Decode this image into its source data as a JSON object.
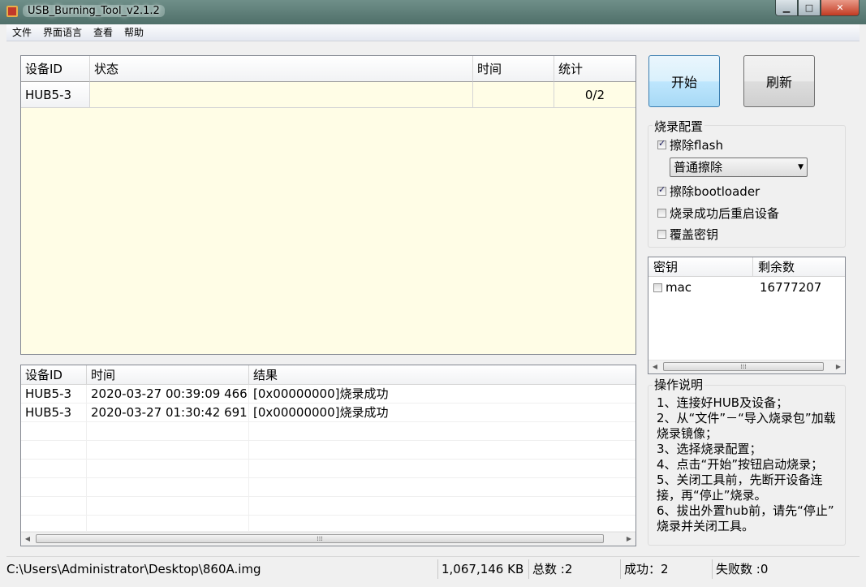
{
  "window": {
    "title": "USB_Burning_Tool_v2.1.2"
  },
  "menu": [
    {
      "label": "文件"
    },
    {
      "label": "界面语言"
    },
    {
      "label": "查看"
    },
    {
      "label": "帮助"
    }
  ],
  "device_grid": {
    "headers": [
      "设备ID",
      "状态",
      "时间",
      "统计"
    ],
    "rows": [
      {
        "id": "HUB5-3",
        "status": "",
        "time": "",
        "stat": "0/2"
      }
    ]
  },
  "buttons": {
    "start": "开始",
    "refresh": "刷新"
  },
  "burn_config": {
    "title": "烧录配置",
    "erase_flash": {
      "label": "擦除flash",
      "checked": true
    },
    "erase_mode": {
      "selected": "普通擦除"
    },
    "erase_bootloader": {
      "label": "擦除bootloader",
      "checked": true
    },
    "reboot_after": {
      "label": "烧录成功后重启设备",
      "checked": false
    },
    "overwrite_key": {
      "label": "覆盖密钥",
      "checked": false
    }
  },
  "key_list": {
    "headers": [
      "密钥",
      "剩余数"
    ],
    "rows": [
      {
        "name": "mac",
        "remaining": "16777207",
        "checked": false
      }
    ]
  },
  "log": {
    "headers": [
      "设备ID",
      "时间",
      "结果"
    ],
    "rows": [
      {
        "id": "HUB5-3",
        "time": "2020-03-27 00:39:09 466",
        "result": "[0x00000000]烧录成功"
      },
      {
        "id": "HUB5-3",
        "time": "2020-03-27 01:30:42 691",
        "result": "[0x00000000]烧录成功"
      }
    ]
  },
  "instructions": {
    "title": "操作说明",
    "lines": [
      "1、连接好HUB及设备；",
      "2、从“文件”－“导入烧录包”加载",
      "烧录镜像；",
      "3、选择烧录配置；",
      "4、点击“开始”按钮启动烧录；",
      "5、关闭工具前，先断开设备连",
      "接，再“停止”烧录。",
      "6、拔出外置hub前，请先“停止”",
      "烧录并关闭工具。"
    ]
  },
  "status_bar": {
    "path": "C:\\Users\\Administrator\\Desktop\\860A.img",
    "size": "1,067,146 KB",
    "total": "总数 :2",
    "success": "成功：2",
    "failed": "失败数 :0"
  }
}
